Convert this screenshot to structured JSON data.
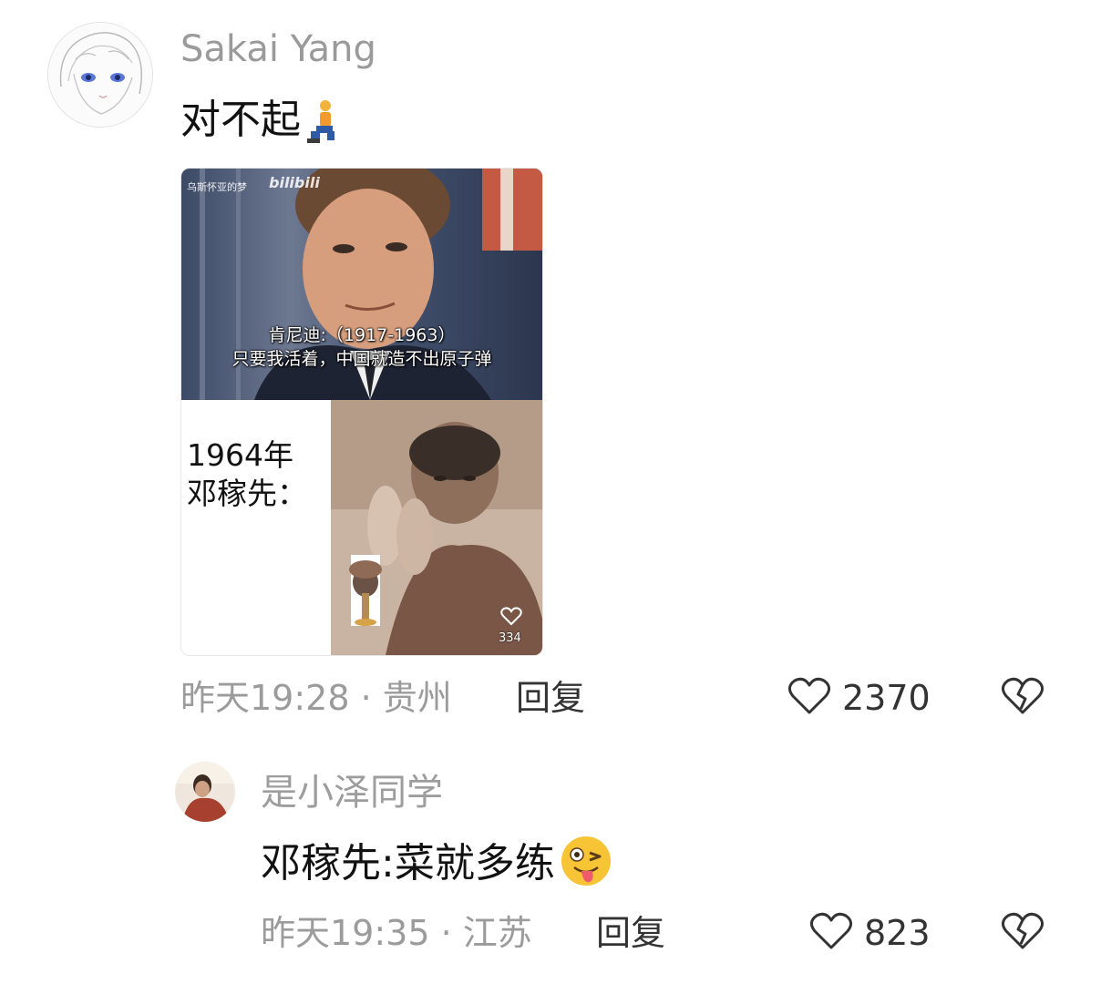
{
  "comment": {
    "username": "Sakai Yang",
    "text": "对不起",
    "emoji": "kneeling-person-emoji",
    "image": {
      "watermark": "乌斯怀亚的梦",
      "watermark_logo": "bilibili",
      "caption_line1": "肯尼迪:（1917-1963）",
      "caption_line2": "只要我活着，中国就造不出原子弹",
      "year_line1": "1964年",
      "year_line2": "邓稼先：",
      "like_count": "334"
    },
    "meta": "昨天19:28 · 贵州",
    "reply_label": "回复",
    "like_count": "2370"
  },
  "reply": {
    "username": "是小泽同学",
    "text": "邓稼先:菜就多练",
    "emoji": "winking-tongue-emoji",
    "meta": "昨天19:35 · 江苏",
    "reply_label": "回复",
    "like_count": "823"
  },
  "colors": {
    "muted": "#9b9b9b",
    "text": "#111111"
  }
}
